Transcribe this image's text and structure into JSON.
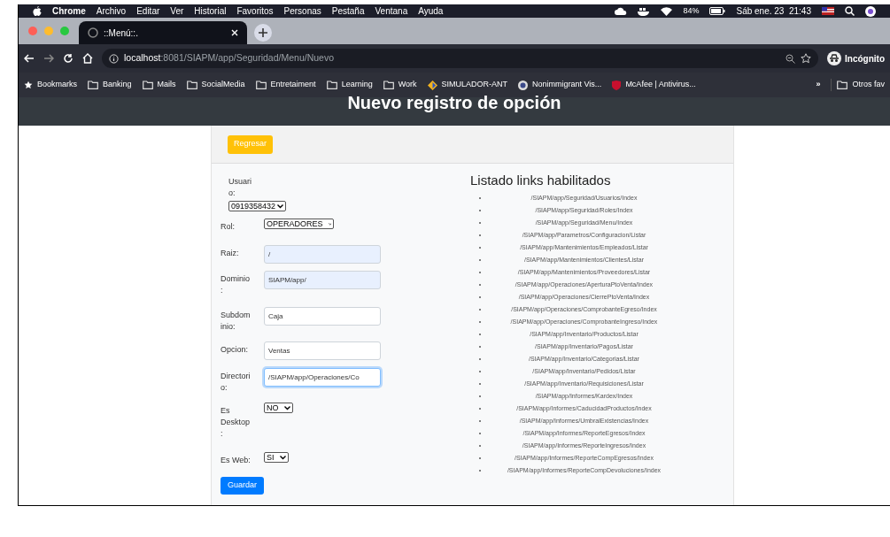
{
  "menubar": {
    "app": "Chrome",
    "menus": [
      "Archivo",
      "Editar",
      "Ver",
      "Historial",
      "Favoritos",
      "Personas",
      "Pestaña",
      "Ventana",
      "Ayuda"
    ],
    "battery": "84%",
    "clock": "Sáb ene. 23  21:43"
  },
  "tabs": [
    {
      "label": "::Menú::.",
      "selected": true
    }
  ],
  "address": {
    "host": "localhost",
    "path": ":8081/SIAPM/app/Seguridad/Menu/Nuevo",
    "profile": "Incógnito"
  },
  "bookmarks": [
    {
      "label": "Bookmarks",
      "kind": "star"
    },
    {
      "label": "Banking",
      "kind": "folder"
    },
    {
      "label": "Mails",
      "kind": "folder"
    },
    {
      "label": "SocialMedia",
      "kind": "folder"
    },
    {
      "label": "Entretaiment",
      "kind": "folder"
    },
    {
      "label": "Learning",
      "kind": "folder"
    },
    {
      "label": "Work",
      "kind": "folder"
    },
    {
      "label": "SIMULADOR-ANT",
      "kind": "app"
    },
    {
      "label": "Nonimmigrant Vis...",
      "kind": "seal"
    },
    {
      "label": "McAfee | Antivirus...",
      "kind": "shield"
    }
  ],
  "bookmarks_more": "»",
  "other_bookmarks": "Otros fav",
  "page": {
    "title": "Nuevo registro de opción",
    "back_button": "Regresar",
    "save_button": "Guardar",
    "usuario": {
      "label": "Usuario:",
      "value": "0919358432"
    },
    "fields": [
      {
        "label": "Rol:",
        "kind": "select",
        "value": "OPERADORES"
      },
      {
        "label": "Raiz:",
        "kind": "text",
        "value": "/",
        "autofilled": true,
        "focused": false
      },
      {
        "label": "Dominio:",
        "kind": "text",
        "value": "SIAPM/app/",
        "autofilled": true,
        "focused": false
      },
      {
        "label": "Subdominio:",
        "kind": "text",
        "value": "Caja",
        "autofilled": false,
        "focused": false
      },
      {
        "label": "Opcion:",
        "kind": "text",
        "value": "Ventas",
        "autofilled": false,
        "focused": false
      },
      {
        "label": "Directorio:",
        "kind": "text",
        "value": "/SIAPM/app/Operaciones/Co",
        "autofilled": false,
        "focused": true
      },
      {
        "label": "Es Desktop:",
        "kind": "select",
        "value": "NO"
      },
      {
        "label": "Es Web:",
        "kind": "select",
        "value": "SI"
      }
    ],
    "links_title": "Listado links habilitados",
    "links": [
      "/SIAPM/app/Seguridad/Usuarios/Index",
      "/SIAPM/app/Seguridad/Roles/Index",
      "/SIAPM/app/Seguridad/Menu/Index",
      "/SIAPM/app/Parametros/Configuracion/Listar",
      "/SIAPM/app/Mantenimientos/Empleados/Listar",
      "/SIAPM/app/Mantenimientos/Clientes/Listar",
      "/SIAPM/app/Mantenimientos/Proveedores/Listar",
      "/SIAPM/app/Operaciones/AperturaPtoVenta/Index",
      "/SIAPM/app/Operaciones/CierrePtoVenta/Index",
      "/SIAPM/app/Operaciones/ComprobanteEgreso/Index",
      "/SIAPM/app/Operaciones/ComprobanteIngreso/Index",
      "/SIAPM/app/Inventario/Productos/Listar",
      "/SIAPM/app/Inventario/Pagos/Listar",
      "/SIAPM/app/Inventario/Categorias/Listar",
      "/SIAPM/app/Inventario/Pedidos/Listar",
      "/SIAPM/app/Inventario/Requisiciones/Listar",
      "/SIAPM/app/Informes/Kardex/Index",
      "/SIAPM/app/Informes/CaducidadProductos/Index",
      "/SIAPM/app/Informes/UmbralExistencias/Index",
      "/SIAPM/app/Informes/ReporteEgresos/Index",
      "/SIAPM/app/Informes/ReporteIngresos/Index",
      "/SIAPM/app/Informes/ReporteCompEgresos/Index",
      "/SIAPM/app/Informes/ReporteCompDevoluciones/Index"
    ]
  }
}
